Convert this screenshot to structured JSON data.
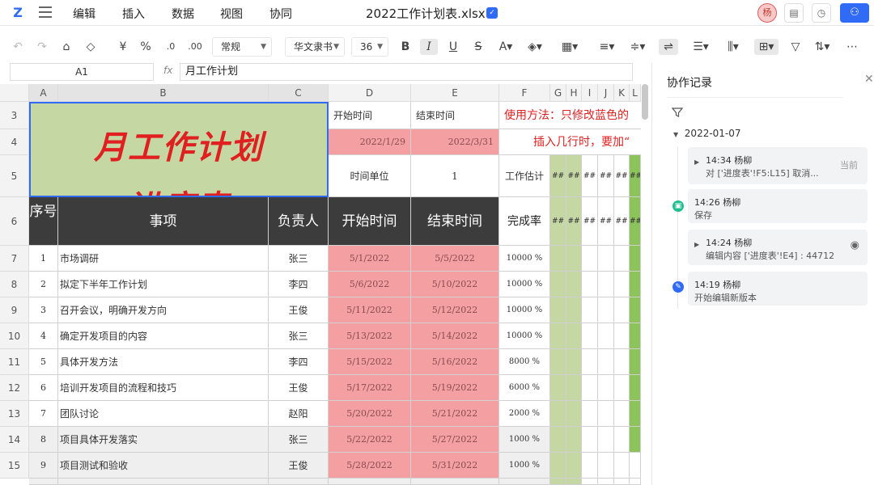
{
  "app": {
    "logo": "Z",
    "doc_title": "2022工作计划表.xlsx",
    "doc_badge": "✓",
    "menu": [
      "编辑",
      "插入",
      "数据",
      "视图",
      "协同"
    ],
    "avatar": "杨",
    "top_icons": [
      "comment-icon",
      "history-icon",
      "share-users-icon"
    ]
  },
  "toolbar": {
    "number_format": "常规",
    "font_name": "华文隶书",
    "font_size": "36",
    "currency": "¥",
    "percent": "%",
    "decimal_dec": ".0",
    "decimal_inc": ".00"
  },
  "formula": {
    "name_box": "A1",
    "fx": "fx",
    "content": "月工作计划"
  },
  "columns": [
    "A",
    "B",
    "C",
    "D",
    "E",
    "F",
    "G",
    "H",
    "I",
    "J",
    "K",
    "L"
  ],
  "rows": [
    "3",
    "4",
    "5",
    "6",
    "7",
    "8",
    "9",
    "10",
    "11",
    "12",
    "13",
    "14",
    "15"
  ],
  "sheet": {
    "title_line1": "月工作计划",
    "title_line2": "进度表",
    "start_label": "开始时间",
    "end_label": "结束时间",
    "start_value": "2022/1/29",
    "end_value": "2022/3/31",
    "note_line1": "使用方法：只修改蓝色的",
    "note_line2": "插入几行时，要加“",
    "unit_label": "时间单位",
    "unit_value": "1",
    "work_est": "工作估计",
    "hash": "##",
    "headers": [
      "序号",
      "事项",
      "负责人",
      "开始时间",
      "结束时间",
      "完成率"
    ],
    "tasks": [
      {
        "no": "1",
        "item": "市场调研",
        "owner": "张三",
        "start": "5/1/2022",
        "end": "5/5/2022",
        "rate": "10000 %"
      },
      {
        "no": "2",
        "item": "拟定下半年工作计划",
        "owner": "李四",
        "start": "5/6/2022",
        "end": "5/10/2022",
        "rate": "10000 %"
      },
      {
        "no": "3",
        "item": "召开会议，明确开发方向",
        "owner": "王俊",
        "start": "5/11/2022",
        "end": "5/12/2022",
        "rate": "10000 %"
      },
      {
        "no": "4",
        "item": "确定开发项目的内容",
        "owner": "张三",
        "start": "5/13/2022",
        "end": "5/14/2022",
        "rate": "10000 %"
      },
      {
        "no": "5",
        "item": "具体开发方法",
        "owner": "李四",
        "start": "5/15/2022",
        "end": "5/16/2022",
        "rate": "8000 %"
      },
      {
        "no": "6",
        "item": "培训开发项目的流程和技巧",
        "owner": "王俊",
        "start": "5/17/2022",
        "end": "5/19/2022",
        "rate": "6000 %"
      },
      {
        "no": "7",
        "item": "团队讨论",
        "owner": "赵阳",
        "start": "5/20/2022",
        "end": "5/21/2022",
        "rate": "2000 %"
      },
      {
        "no": "8",
        "item": "项目具体开发落实",
        "owner": "张三",
        "start": "5/22/2022",
        "end": "5/27/2022",
        "rate": "1000 %"
      },
      {
        "no": "9",
        "item": "项目测试和验收",
        "owner": "王俊",
        "start": "5/28/2022",
        "end": "5/31/2022",
        "rate": "1000 %"
      }
    ]
  },
  "panel": {
    "title": "协作记录",
    "date": "2022-01-07",
    "entries": [
      {
        "time": "14:34 杨柳",
        "desc": "对 ['进度表'!F5:L15] 取消...",
        "tag": "当前"
      },
      {
        "time": "14:26 杨柳",
        "desc": "保存"
      },
      {
        "time": "14:24 杨柳",
        "desc": "编辑内容 ['进度表'!E4] : 44712"
      },
      {
        "time": "14:19 杨柳",
        "desc": "开始编辑新版本"
      }
    ]
  }
}
